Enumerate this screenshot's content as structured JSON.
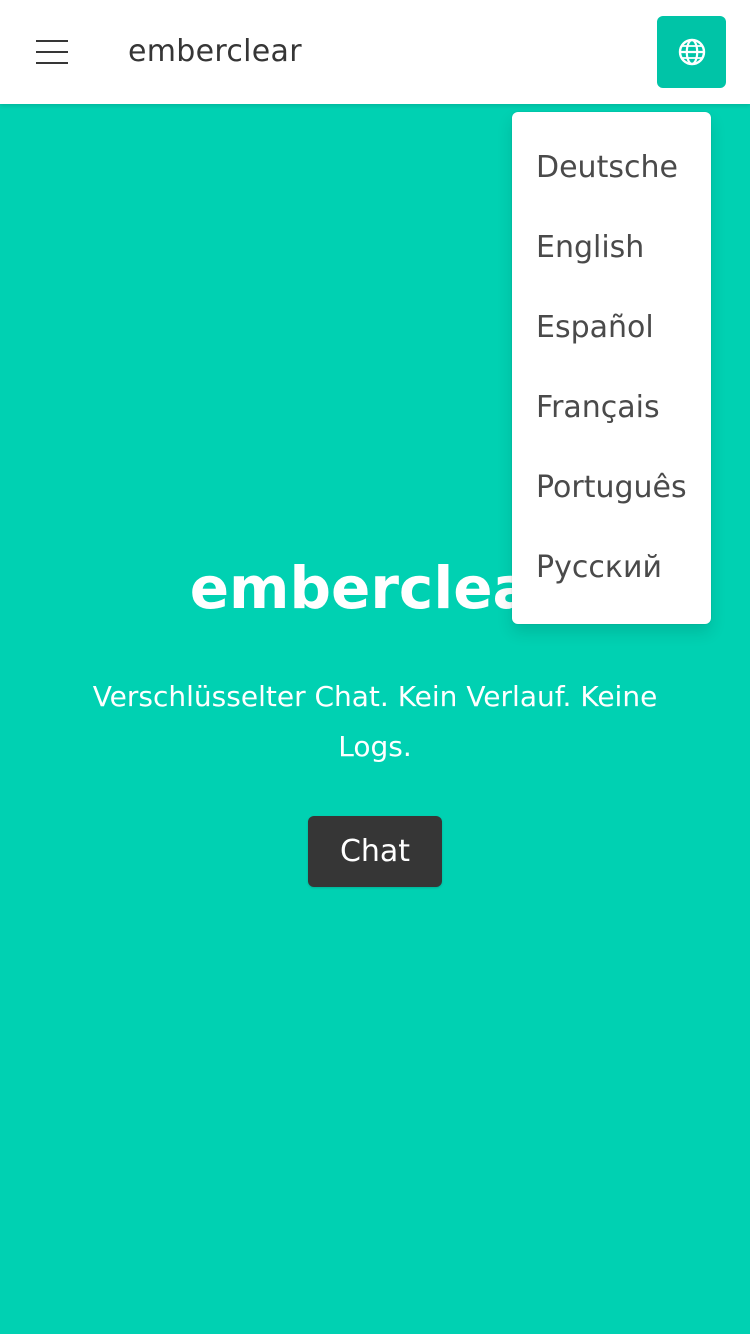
{
  "navbar": {
    "menu_icon": "hamburger-menu-icon",
    "brand": "emberclear",
    "language_icon": "globe-icon"
  },
  "hero": {
    "title": "emberclear",
    "subtitle": "Verschlüsselter Chat. Kein Verlauf. Keine Logs.",
    "chat_button": "Chat"
  },
  "language_dropdown": {
    "items": [
      {
        "label": "Deutsche"
      },
      {
        "label": "English"
      },
      {
        "label": "Español"
      },
      {
        "label": "Français"
      },
      {
        "label": "Português"
      },
      {
        "label": "Русский"
      }
    ]
  },
  "colors": {
    "primary": "#00d1b2",
    "primary_dark": "#00c4a7",
    "dark": "#363636",
    "white": "#ffffff"
  }
}
